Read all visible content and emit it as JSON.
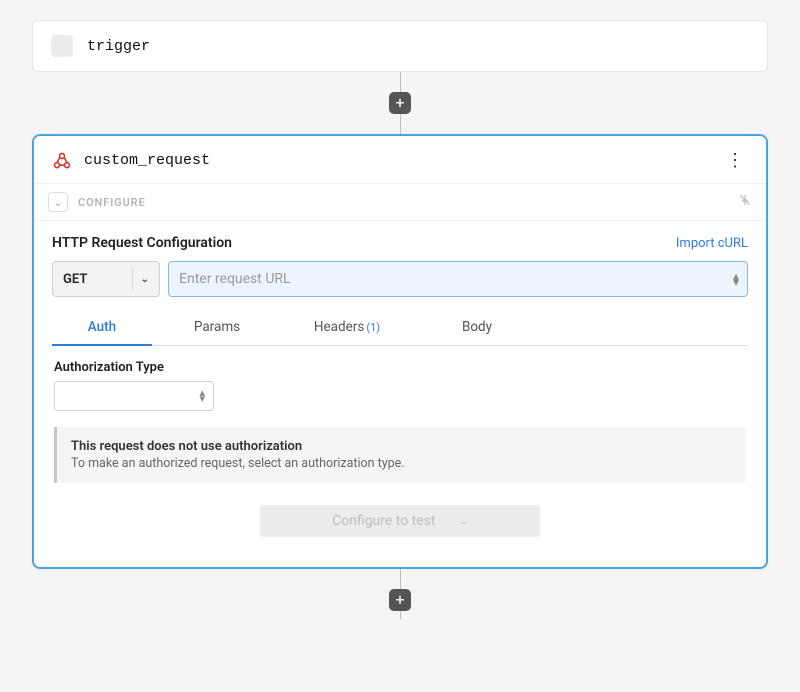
{
  "trigger": {
    "label": "trigger"
  },
  "step": {
    "title": "custom_request",
    "configure_label": "CONFIGURE",
    "section_title": "HTTP Request Configuration",
    "import_link": "Import cURL",
    "method": {
      "selected": "GET"
    },
    "url_input": {
      "placeholder": "Enter request URL"
    },
    "tabs": [
      {
        "label": "Auth",
        "active": true
      },
      {
        "label": "Params",
        "active": false
      },
      {
        "label": "Headers",
        "badge": "(1)",
        "active": false
      },
      {
        "label": "Body",
        "active": false
      }
    ],
    "auth": {
      "field_label": "Authorization Type",
      "notice_title": "This request does not use authorization",
      "notice_text": "To make an authorized request, select an authorization type."
    },
    "footer_button": "Configure to test"
  }
}
